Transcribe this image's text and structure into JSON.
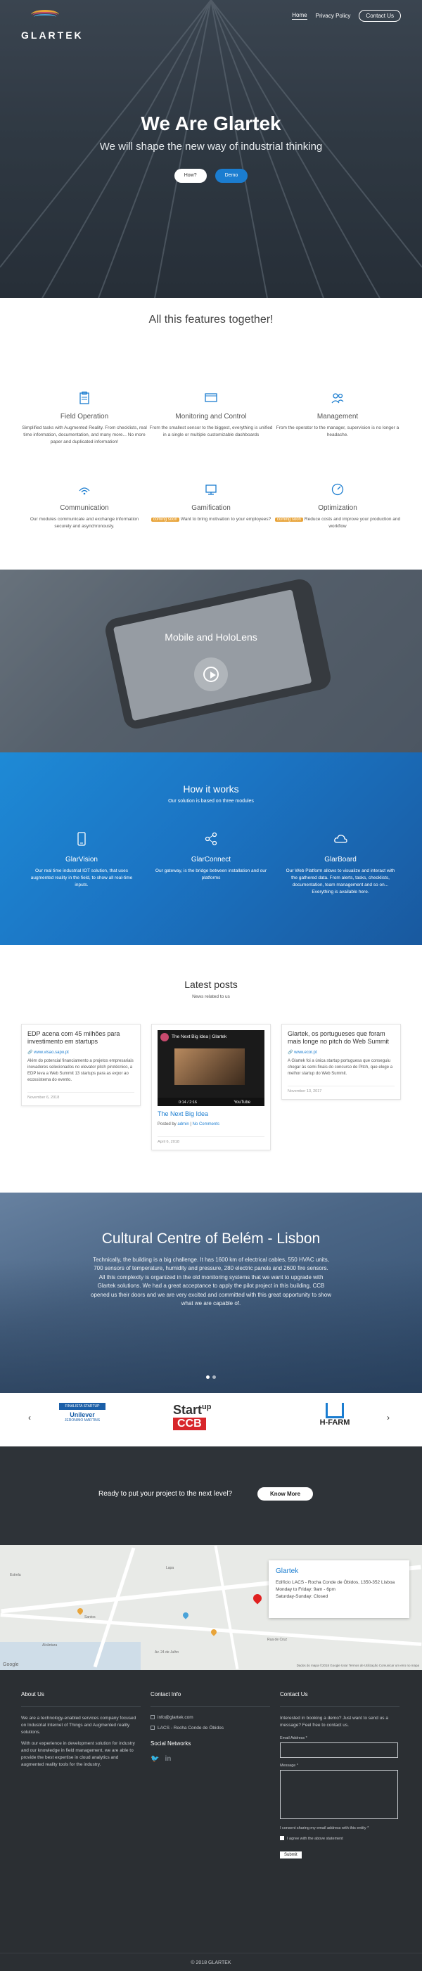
{
  "nav": {
    "logo": "GLARTEK",
    "items": [
      "Home",
      "Privacy Policy",
      "Contact Us"
    ]
  },
  "hero": {
    "title": "We Are Glartek",
    "subtitle": "We will shape the new way of industrial thinking",
    "btn_how": "How?",
    "btn_demo": "Demo"
  },
  "features": {
    "heading": "All this features together!",
    "items": [
      {
        "icon": "clipboard-icon",
        "title": "Field Operation",
        "desc": "Simplified tasks with Augmented Reality. From checklists, real time information, documentation, and many more... No more paper and duplicated information!"
      },
      {
        "icon": "monitor-icon",
        "title": "Monitoring and Control",
        "desc": "From the smallest sensor to the biggest, everything is unified in a single or multiple customizable dashboards"
      },
      {
        "icon": "users-icon",
        "title": "Management",
        "desc": "From the operator to the manager, supervision is no longer a headache."
      },
      {
        "icon": "wifi-icon",
        "title": "Communication",
        "desc": "Our modules communicate and exchange information securely and asynchronously."
      },
      {
        "icon": "desktop-icon",
        "title": "Gamification",
        "tag": "coming soon",
        "desc": "Want to bring motivation to your employees?"
      },
      {
        "icon": "gauge-icon",
        "title": "Optimization",
        "tag": "coming soon",
        "desc": "Reduce costs and improve your production and workflow"
      }
    ]
  },
  "video": {
    "title": "Mobile and HoloLens"
  },
  "how": {
    "heading": "How it works",
    "sub": "Our solution is based on three modules",
    "modules": [
      {
        "icon": "phone-icon",
        "title": "GlarVision",
        "desc": "Our real time industrial IOT solution, that uses augmented reality in the field, to show all real-time inputs."
      },
      {
        "icon": "share-icon",
        "title": "GlarConnect",
        "desc": "Our gateway, is the bridge between installation and our platforms"
      },
      {
        "icon": "cloud-icon",
        "title": "GlarBoard",
        "desc": "Our Web Platform allows to visualize and interact with the gathered data. From alerts, tasks, checklists, documentation, team management and so on... Everything is available here."
      }
    ]
  },
  "posts": {
    "heading": "Latest posts",
    "sub": "News related to us",
    "cards": [
      {
        "title": "EDP acena com 45 milhões para investimento em startups",
        "link": "www.visao.sapo.pt",
        "body": "Além do potencial financiamento a projetos empresariais inovadores selecionados no elevator pitch pirotécnico, a EDP leva a Web Summit 13 startups para as expor ao ecossistema do evento.",
        "date": "November 6, 2018"
      },
      {
        "video_title": "The Next Big Idea | Glartek",
        "video_time": "0:14 / 2:16",
        "video_brand": "YouTube",
        "title": "The Next Big Idea",
        "by": "Posted by",
        "author": "admin",
        "comments": "No Comments",
        "date": "April 6, 2018"
      },
      {
        "title": "Glartek, os portugueses que foram mais longe no pitch do Web Summit",
        "link": "www.ecor.pt",
        "body": "A Glartek foi a única startup portuguesa que conseguiu chegar às semi-finais do concurso de Pitch, que elege a melhor startup do Web Summit.",
        "date": "November 13, 2017"
      }
    ]
  },
  "cultural": {
    "heading": "Cultural Centre of Belém - Lisbon",
    "para": "Technically, the building is a big challenge. It has 1600 km of electrical cables, 550 HVAC units, 700 sensors of temperature, humidity and pressure, 280 electric panels and 2600 fire sensors. All this complexity is organized in the old monitoring systems that we want to upgrade with Glartek solutions. We had a great acceptance to apply the pilot project in this building. CCB opened us their doors and we are very excited and committed with this great opportunity to show what we are capable of."
  },
  "partners": [
    {
      "stripe": "FINALISTA STARTUP",
      "name": "Unilever",
      "sub": "JERONIMO MARTINS"
    },
    {
      "t1": "Start",
      "t1b": "up",
      "t2": "CCB"
    },
    {
      "name": "H-FARM"
    }
  ],
  "cta": {
    "text": "Ready to put your project to the next level?",
    "btn": "Know More"
  },
  "map": {
    "title": "Glartek",
    "address": "Edifício LACS - Rocha Conde de Óbidos, 1350-352 Lisboa",
    "hours1": "Monday to Friday: 9am - 6pm",
    "hours2": "Saturday-Sunday: Closed",
    "google": "Google",
    "terms": "Dados do mapa ©2018 Google  Usar Termos de Utilização  Comunicar um erro no mapa",
    "labels": [
      "Estrela",
      "Santos",
      "Alcântara",
      "Lapa",
      "Av. 24 de Julho",
      "Rua de Cruz"
    ]
  },
  "footer": {
    "about_h": "About Us",
    "about_1": "We are a technology-enabled services company focused on Industrial Internet of Things and Augmented reality solutions.",
    "about_2": "With our experience in development solution for industry and our knowledge in field management, we are able to provide the best expertise in cloud analytics and augmented reality tools for the industry.",
    "contact_h": "Contact Info",
    "email": "info@glartek.com",
    "address": "LACS - Rocha Conde de Óbidos",
    "social_h": "Social Networks",
    "contact_us_h": "Contact Us",
    "contact_us_text": "Interested in booking a demo? Just want to send us a message? Feel free to contact us.",
    "email_label": "Email Address *",
    "message_label": "Message *",
    "consent": "I consent sharing my email address with this entity *",
    "agree": "I agree with the above statement",
    "submit": "Submit",
    "copyright": "© 2018 GLARTEK"
  }
}
